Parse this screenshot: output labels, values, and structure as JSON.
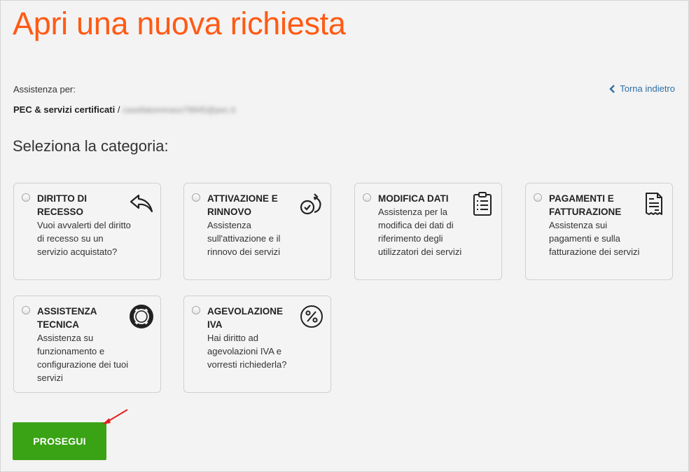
{
  "page": {
    "title": "Apri una nuova richiesta"
  },
  "assistance": {
    "label": "Assistenza per:",
    "service": "PEC & servizi certificati",
    "separator": " / ",
    "email_redacted": "casellatommaso78945@pec.it"
  },
  "back_link": {
    "label": "Torna indietro",
    "icon": "chevron-left-icon"
  },
  "section": {
    "title": "Seleziona la categoria:"
  },
  "categories": [
    {
      "title": "DIRITTO DI RECESSO",
      "description": "Vuoi avvalerti del diritto di recesso su un servizio acquistato?",
      "icon": "undo-arrow-icon",
      "selected": false
    },
    {
      "title": "ATTIVAZIONE E RINNOVO",
      "description": "Assistenza sull'attivazione e il rinnovo dei servizi",
      "icon": "renew-check-icon",
      "selected": false
    },
    {
      "title": "MODIFICA DATI",
      "description": "Assistenza per la modifica dei dati di riferimento degli utilizzatori dei servizi",
      "icon": "clipboard-list-icon",
      "selected": false
    },
    {
      "title": "PAGAMENTI E FATTURAZIONE",
      "description": "Assistenza sui pagamenti e sulla fatturazione dei servizi",
      "icon": "receipt-icon",
      "selected": false
    },
    {
      "title": "ASSISTENZA TECNICA",
      "description": "Assistenza su funzionamento e configurazione dei tuoi servizi",
      "icon": "lifebuoy-icon",
      "selected": false
    },
    {
      "title": "AGEVOLAZIONE IVA",
      "description": "Hai diritto ad agevolazioni IVA e vorresti richiederla?",
      "icon": "percent-icon",
      "selected": false
    }
  ],
  "actions": {
    "continue_label": "PROSEGUI"
  },
  "colors": {
    "title": "#ff5a14",
    "button": "#3aa315",
    "link": "#2f6ea6",
    "annotation_arrow": "#e02020"
  }
}
